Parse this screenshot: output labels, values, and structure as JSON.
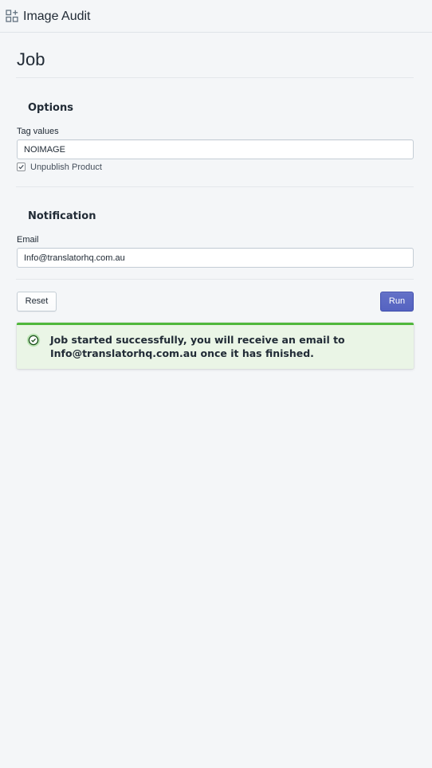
{
  "app": {
    "title": "Image Audit",
    "icon": "apps-grid-icon"
  },
  "page": {
    "title": "Job"
  },
  "options": {
    "section_title": "Options",
    "tag_label": "Tag values",
    "tag_value": "NOIMAGE",
    "unpublish_label": "Unpublish Product",
    "unpublish_checked": true
  },
  "notification": {
    "section_title": "Notification",
    "email_label": "Email",
    "email_value": "Info@translatorhq.com.au"
  },
  "actions": {
    "reset_label": "Reset",
    "run_label": "Run"
  },
  "banner": {
    "status": "success",
    "icon": "check-circle-icon",
    "message": "Job started successfully, you will receive an email to Info@translatorhq.com.au once it has finished."
  },
  "colors": {
    "primary": "#5c6ac4",
    "success": "#50b83c",
    "success_bg": "#eaf5e6",
    "page_bg": "#f4f6f8"
  }
}
